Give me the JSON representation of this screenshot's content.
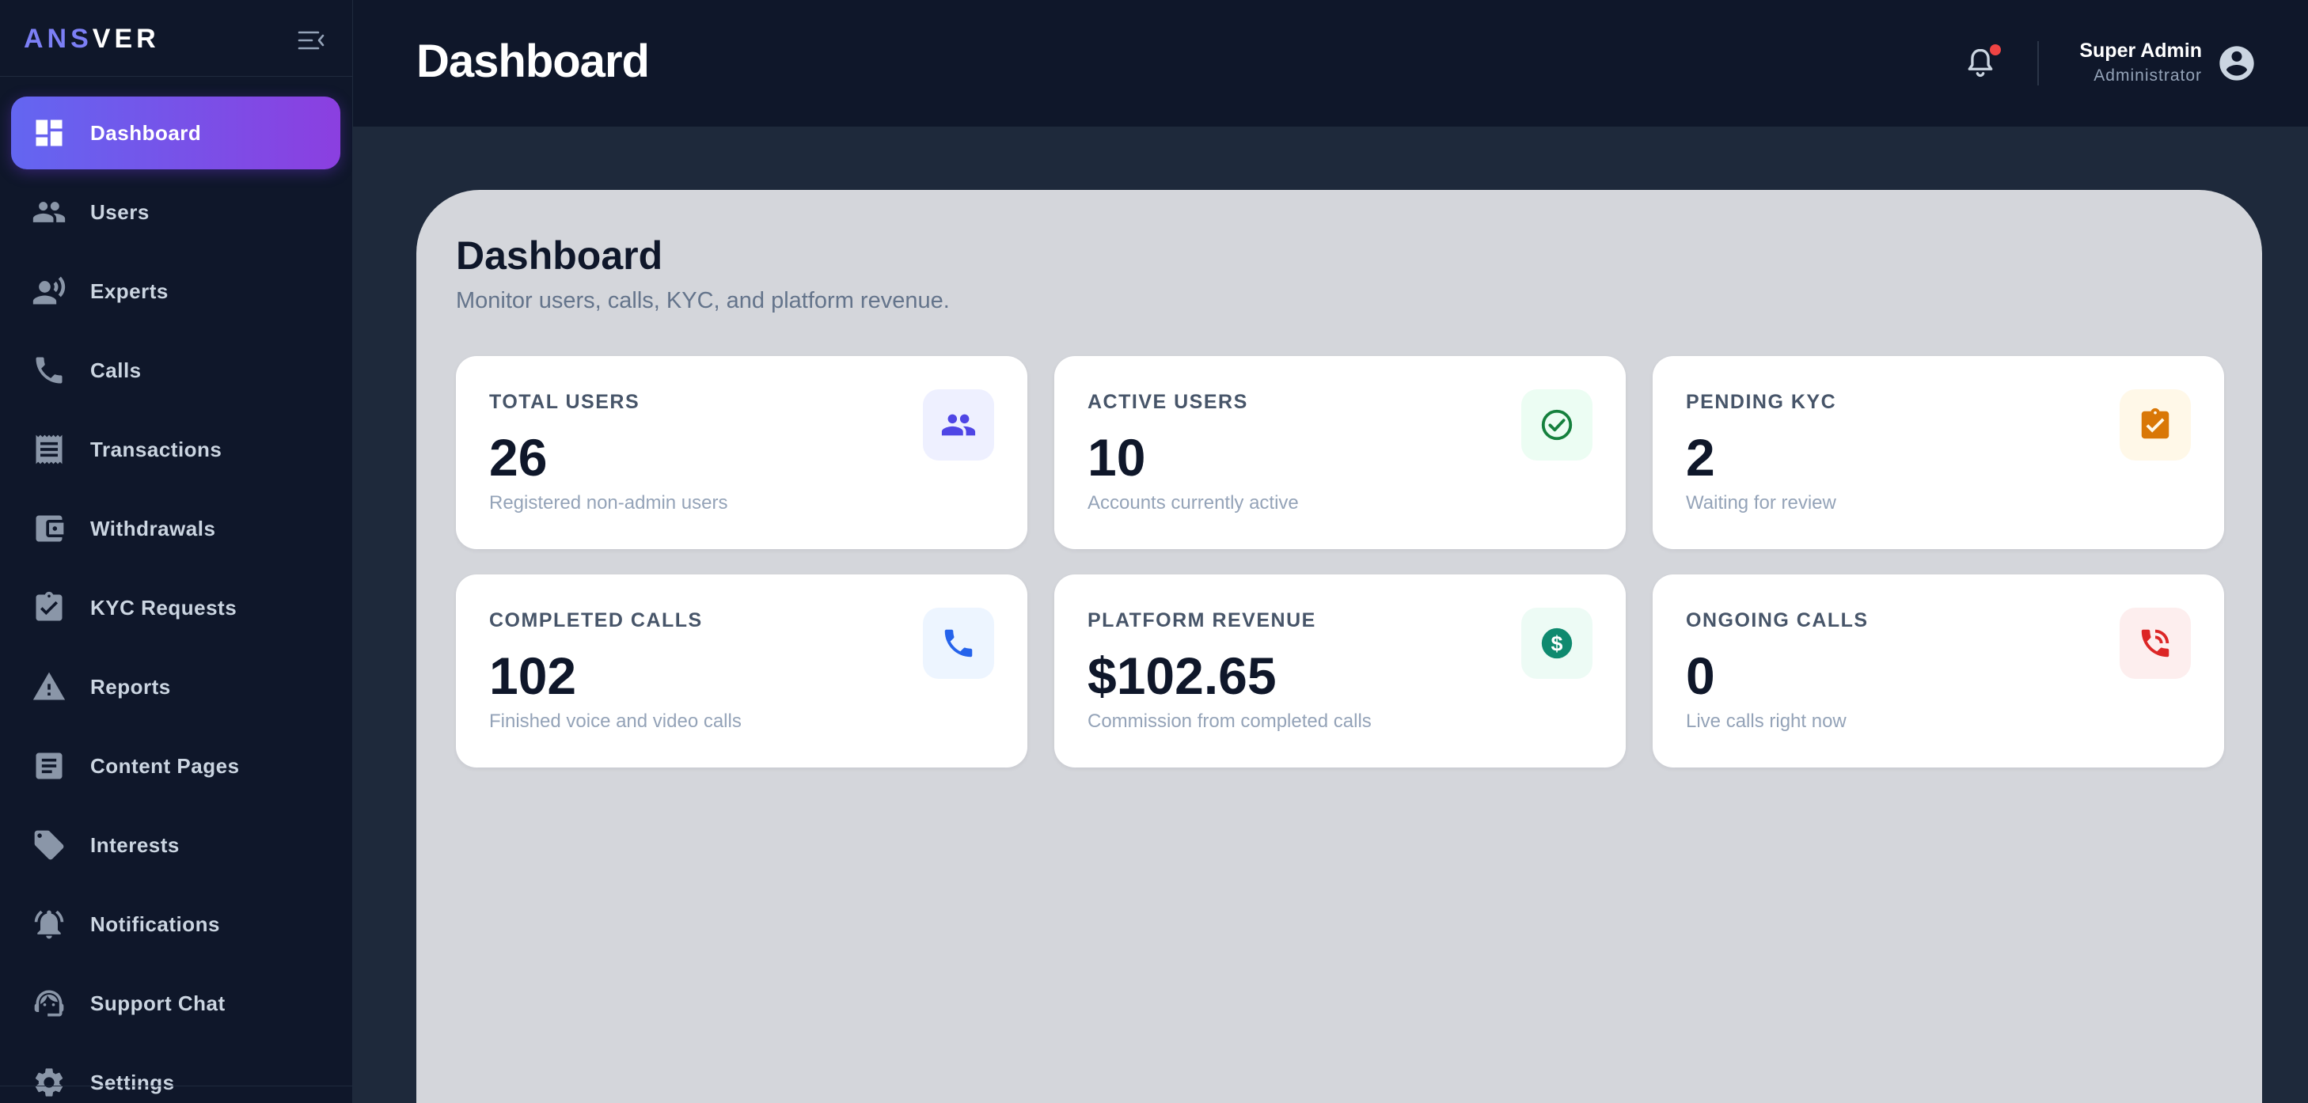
{
  "brand": {
    "part1": "ANS",
    "part2": "VER"
  },
  "sidebar": {
    "items": [
      {
        "label": "Dashboard",
        "icon": "dashboard-icon",
        "active": true
      },
      {
        "label": "Users",
        "icon": "users-icon"
      },
      {
        "label": "Experts",
        "icon": "expert-icon"
      },
      {
        "label": "Calls",
        "icon": "phone-icon"
      },
      {
        "label": "Transactions",
        "icon": "receipt-icon"
      },
      {
        "label": "Withdrawals",
        "icon": "wallet-icon"
      },
      {
        "label": "KYC Requests",
        "icon": "clipboard-check-icon"
      },
      {
        "label": "Reports",
        "icon": "warning-icon"
      },
      {
        "label": "Content Pages",
        "icon": "article-icon"
      },
      {
        "label": "Interests",
        "icon": "tag-icon"
      },
      {
        "label": "Notifications",
        "icon": "bell-icon"
      },
      {
        "label": "Support Chat",
        "icon": "support-agent-icon"
      },
      {
        "label": "Settings",
        "icon": "gear-icon"
      }
    ]
  },
  "header": {
    "title": "Dashboard",
    "user_name": "Super Admin",
    "user_role": "Administrator"
  },
  "main": {
    "title": "Dashboard",
    "subtitle": "Monitor users, calls, KYC, and platform revenue.",
    "stats": [
      {
        "label": "TOTAL USERS",
        "value": "26",
        "desc": "Registered non-admin users",
        "icon": "users-icon",
        "icon_color": "#4f46e5",
        "icon_bg": "#eef0ff"
      },
      {
        "label": "ACTIVE USERS",
        "value": "10",
        "desc": "Accounts currently active",
        "icon": "check-circle-icon",
        "icon_color": "#15803d",
        "icon_bg": "#ecfdf3"
      },
      {
        "label": "PENDING KYC",
        "value": "2",
        "desc": "Waiting for review",
        "icon": "clipboard-check-icon",
        "icon_color": "#d97706",
        "icon_bg": "#fff8e8"
      },
      {
        "label": "COMPLETED CALLS",
        "value": "102",
        "desc": "Finished voice and video calls",
        "icon": "phone-icon",
        "icon_color": "#2563eb",
        "icon_bg": "#edf5ff"
      },
      {
        "label": "PLATFORM REVENUE",
        "value": "$102.65",
        "desc": "Commission from completed calls",
        "icon": "dollar-icon",
        "icon_color": "#0f8a6f",
        "icon_bg": "#edfbf5"
      },
      {
        "label": "ONGOING CALLS",
        "value": "0",
        "desc": "Live calls right now",
        "icon": "phone-in-talk-icon",
        "icon_color": "#dc2626",
        "icon_bg": "#fdeeee"
      }
    ]
  }
}
